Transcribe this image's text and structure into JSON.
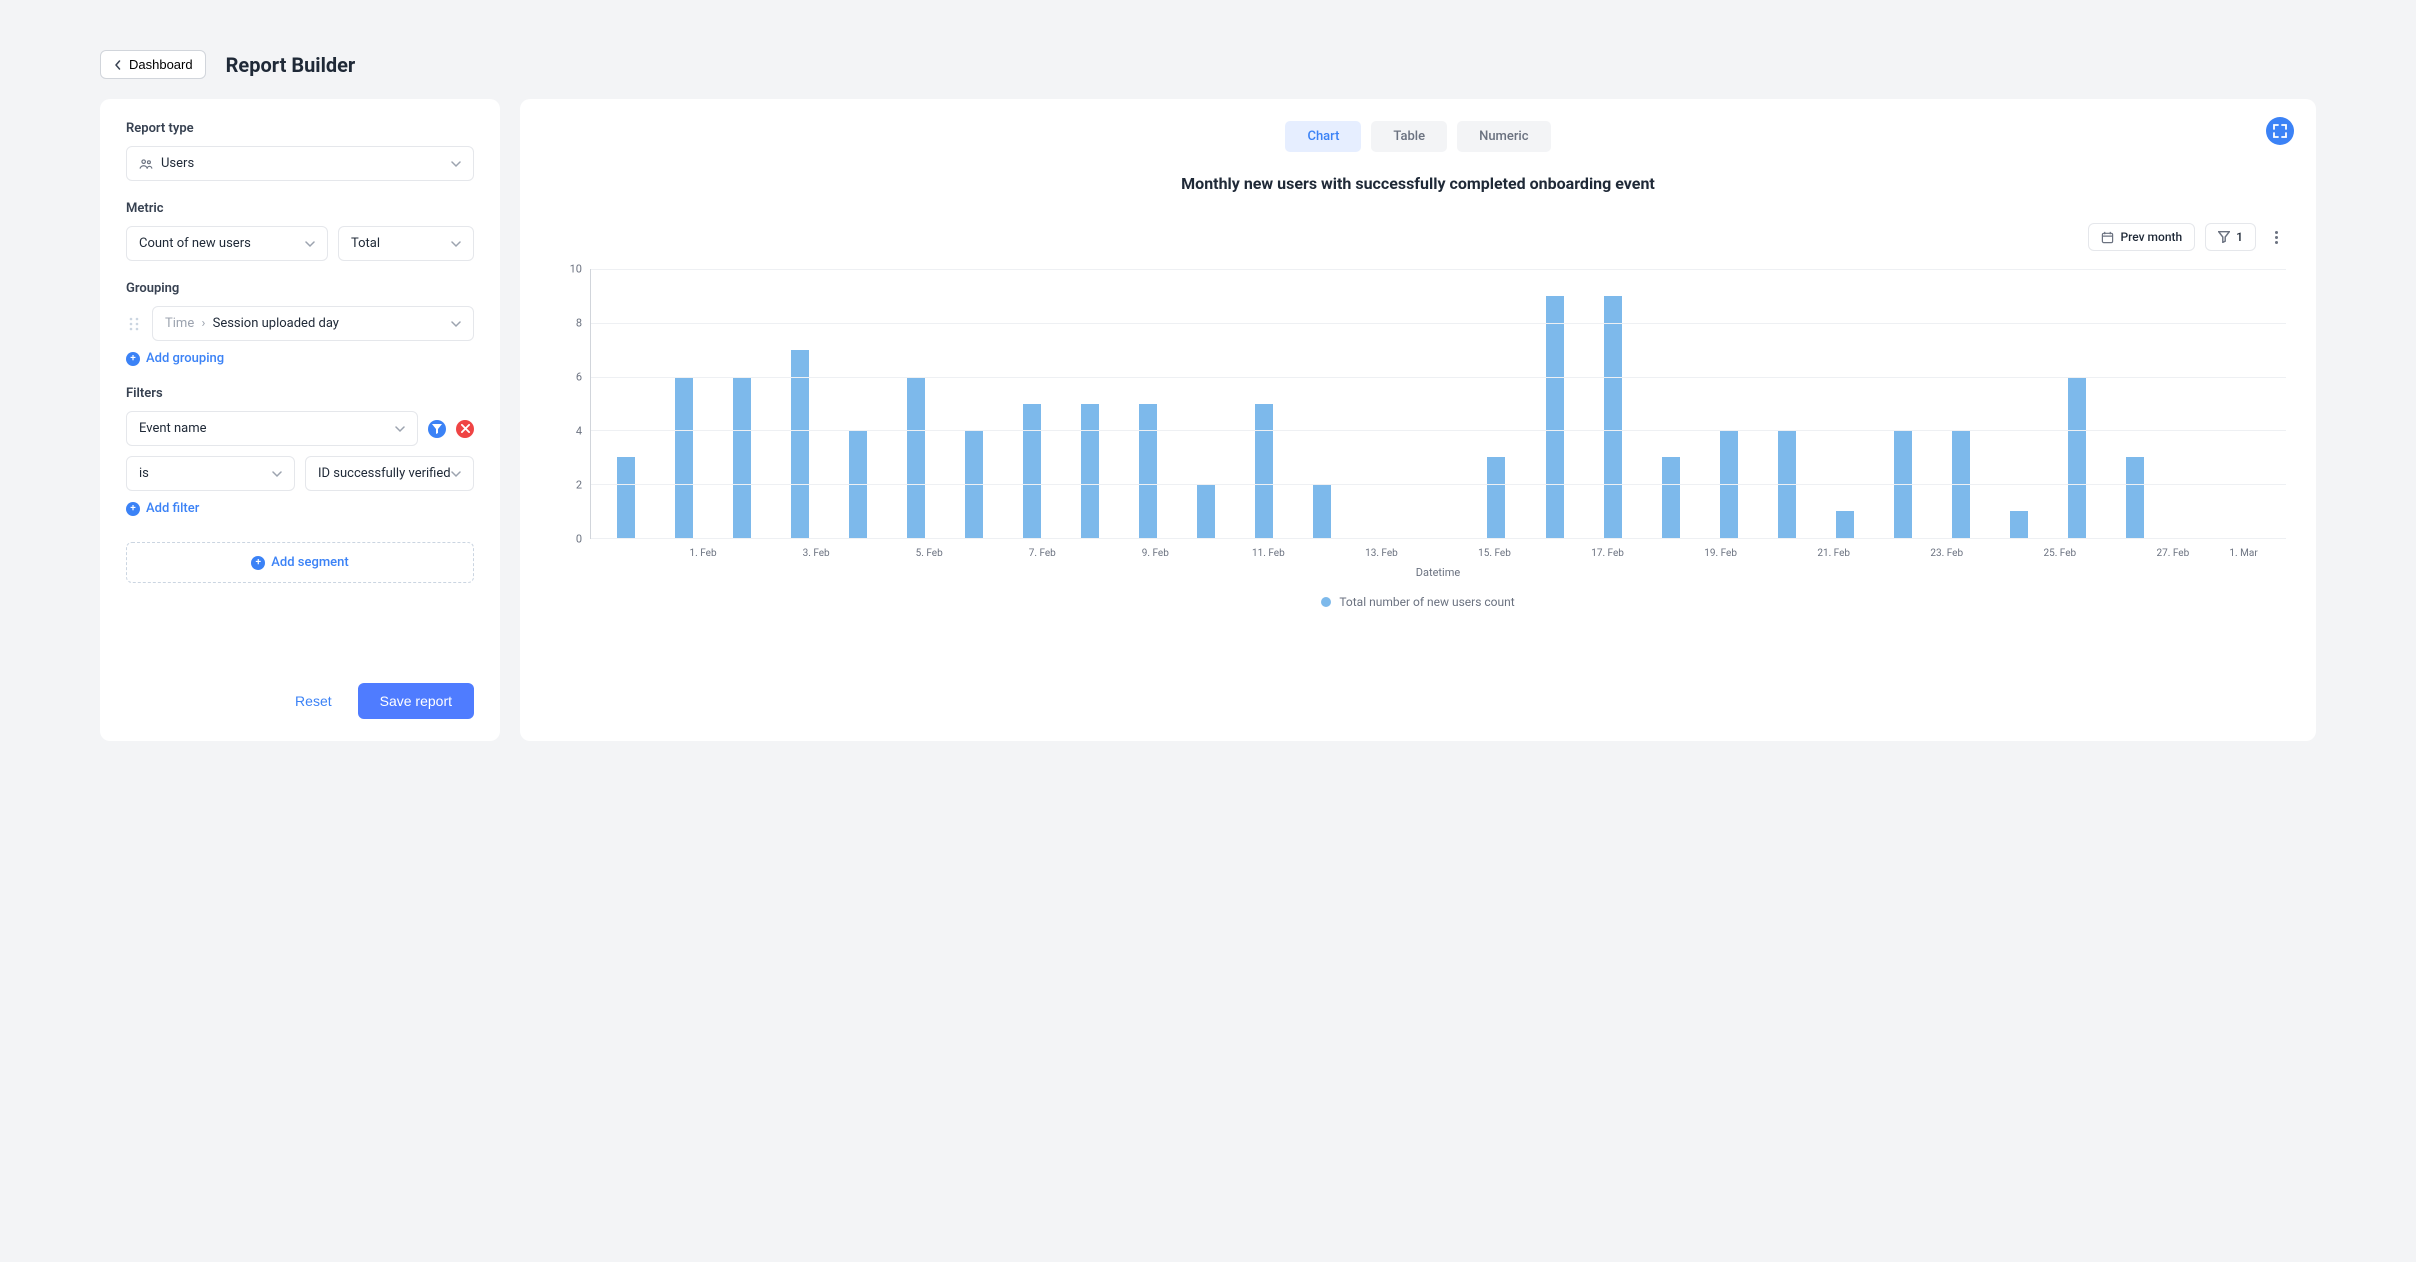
{
  "header": {
    "back_label": "Dashboard",
    "page_title": "Report Builder"
  },
  "left": {
    "report_type": {
      "label": "Report type",
      "value": "Users"
    },
    "metric": {
      "label": "Metric",
      "value": "Count of new users",
      "agg": "Total"
    },
    "grouping": {
      "label": "Grouping",
      "prefix": "Time",
      "value": "Session uploaded day",
      "add_label": "Add grouping"
    },
    "filters": {
      "label": "Filters",
      "field": "Event name",
      "operator": "is",
      "value": "ID successfully verified",
      "add_label": "Add filter"
    },
    "segment": {
      "add_label": "Add segment"
    },
    "footer": {
      "reset": "Reset",
      "save": "Save report"
    }
  },
  "right": {
    "tabs": {
      "chart": "Chart",
      "table": "Table",
      "numeric": "Numeric"
    },
    "chart_title": "Monthly new users with successfully completed onboarding event",
    "controls": {
      "date_range": "Prev month",
      "filter_count": "1"
    },
    "x_label": "Datetime",
    "legend": "Total number of new users count"
  },
  "chart_data": {
    "type": "bar",
    "title": "Monthly new users with successfully completed onboarding event",
    "xlabel": "Datetime",
    "ylabel": "",
    "ylim": [
      0,
      10
    ],
    "yticks": [
      0,
      2,
      4,
      6,
      8,
      10
    ],
    "x_tick_labels": [
      "1. Feb",
      "3. Feb",
      "5. Feb",
      "7. Feb",
      "9. Feb",
      "11. Feb",
      "13. Feb",
      "15. Feb",
      "17. Feb",
      "19. Feb",
      "21. Feb",
      "23. Feb",
      "25. Feb",
      "27. Feb",
      "1. Mar"
    ],
    "categories": [
      "1. Feb",
      "2. Feb",
      "3. Feb",
      "4. Feb",
      "5. Feb",
      "6. Feb",
      "7. Feb",
      "8. Feb",
      "9. Feb",
      "10. Feb",
      "11. Feb",
      "12. Feb",
      "13. Feb",
      "14. Feb",
      "15. Feb",
      "16. Feb",
      "17. Feb",
      "18. Feb",
      "19. Feb",
      "20. Feb",
      "21. Feb",
      "22. Feb",
      "23. Feb",
      "24. Feb",
      "25. Feb",
      "26. Feb",
      "27. Feb",
      "28. Feb",
      "1. Mar"
    ],
    "series": [
      {
        "name": "Total number of new users count",
        "values": [
          3,
          6,
          6,
          7,
          4,
          6,
          4,
          5,
          5,
          5,
          2,
          5,
          2,
          0,
          0,
          3,
          9,
          9,
          3,
          4,
          4,
          1,
          4,
          4,
          1,
          6,
          3,
          0,
          0
        ]
      }
    ]
  }
}
